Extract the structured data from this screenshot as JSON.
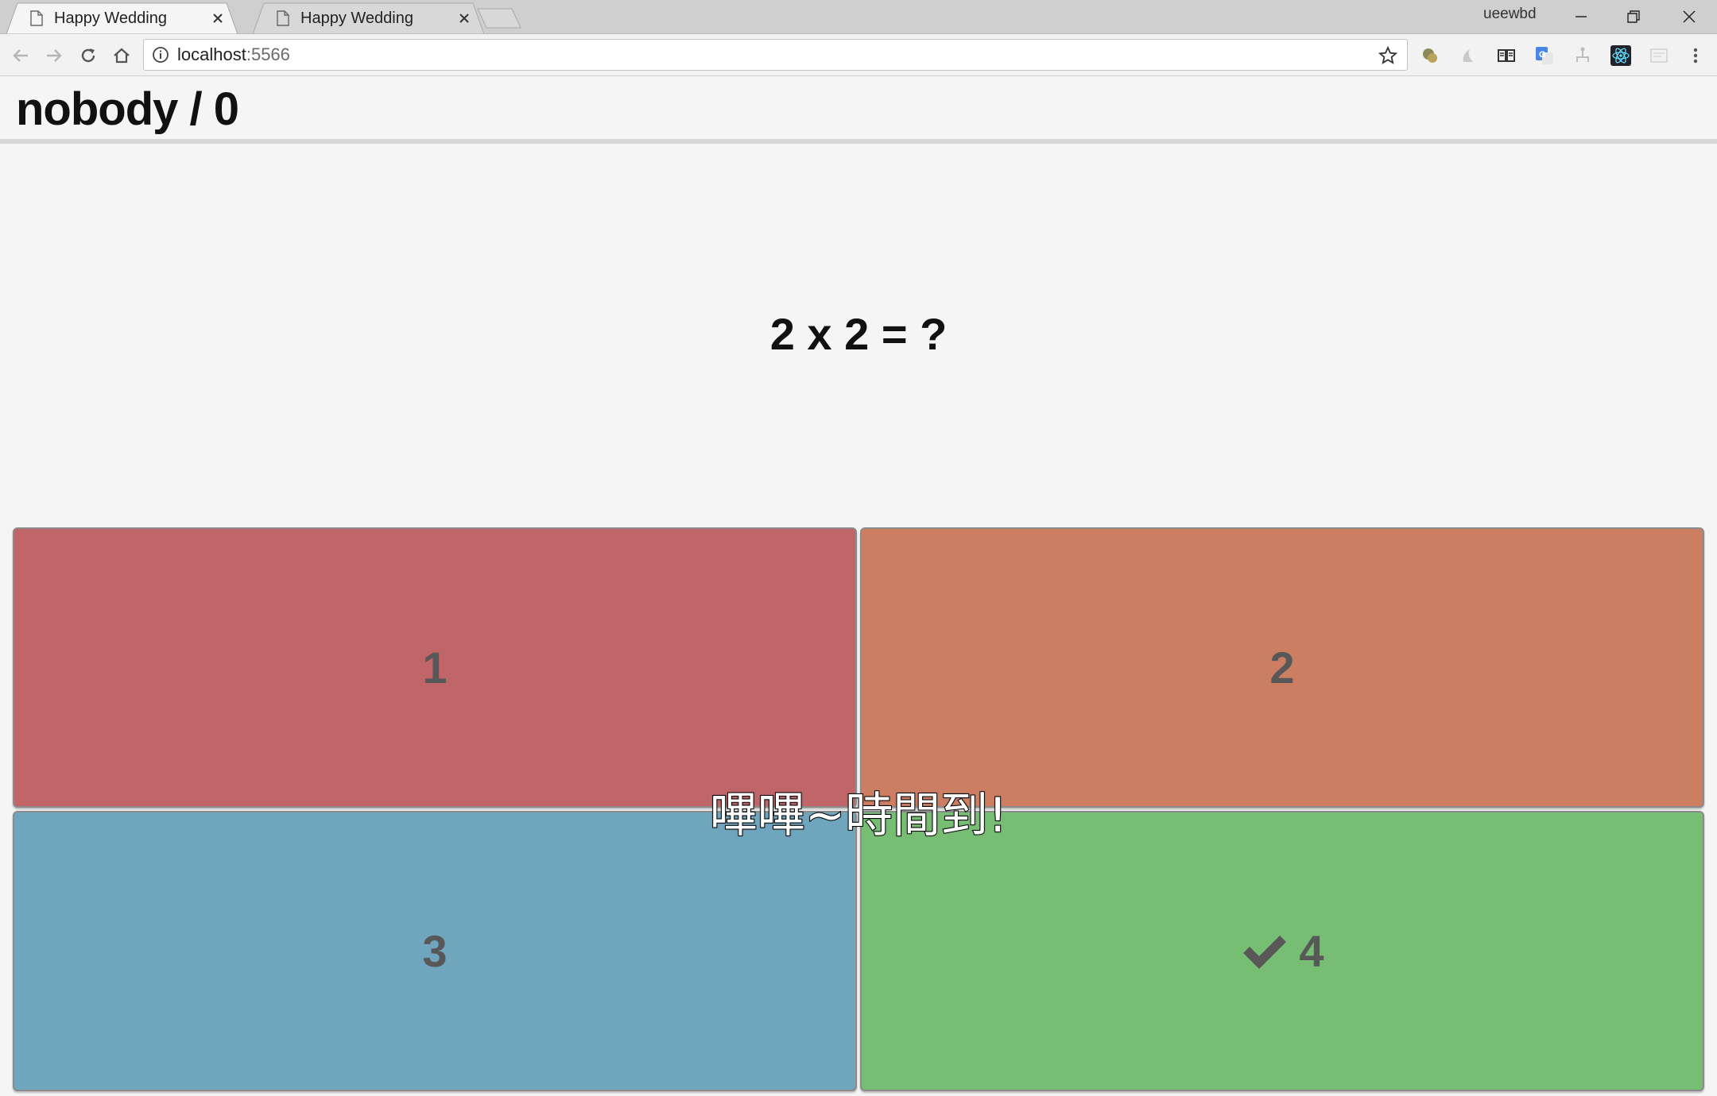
{
  "browser": {
    "tabs": [
      {
        "title": "Happy Wedding",
        "active": true
      },
      {
        "title": "Happy Wedding",
        "active": false
      }
    ],
    "profile_name": "ueewbd",
    "url_host": "localhost",
    "url_port": ":5566",
    "extension_icons": [
      "ext-icon-1",
      "ext-icon-2",
      "reader-icon",
      "translate-icon",
      "ext-icon-5",
      "react-devtools-icon",
      "ext-icon-7"
    ]
  },
  "game": {
    "player": "nobody / 0",
    "question": "2 x 2 = ?",
    "answers": [
      {
        "label": "1",
        "color": "#c06668",
        "correct": false
      },
      {
        "label": "2",
        "color": "#cc7e62",
        "correct": false
      },
      {
        "label": "3",
        "color": "#6fa5bd",
        "correct": false
      },
      {
        "label": "4",
        "color": "#77be74",
        "correct": true
      }
    ],
    "timeup_message": "嗶嗶~時間到!"
  }
}
